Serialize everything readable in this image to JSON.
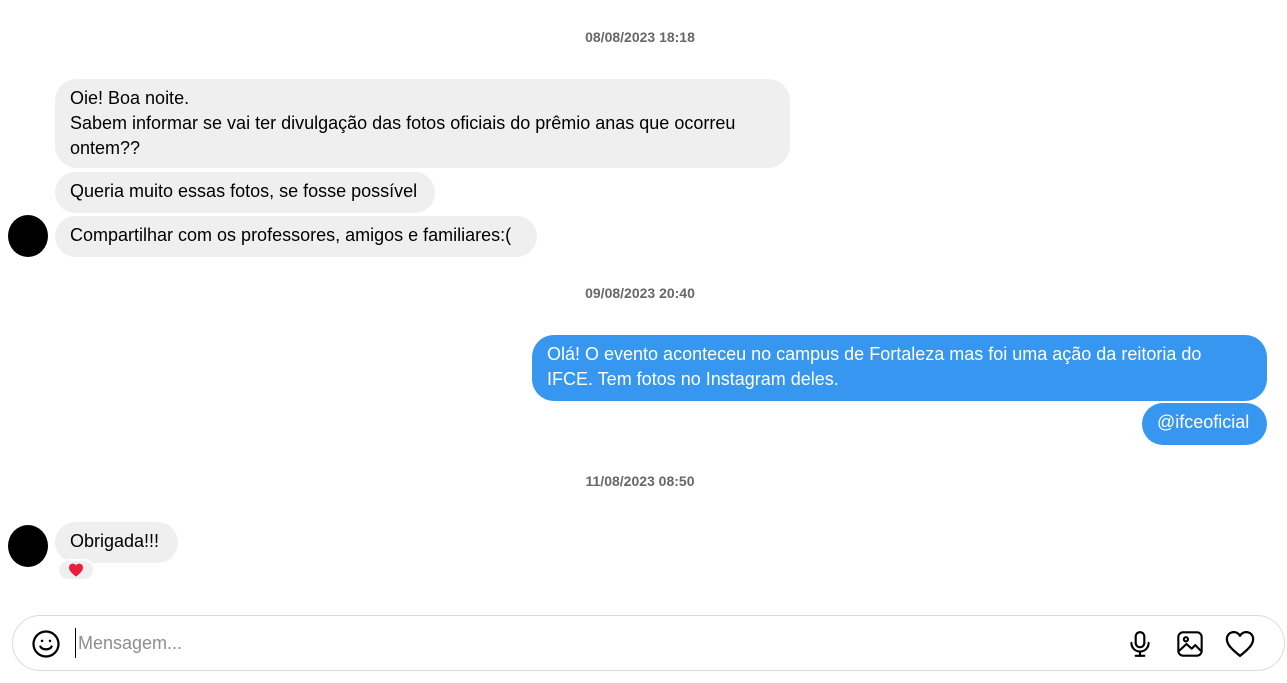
{
  "conversation": {
    "timestamps": [
      "08/08/2023 18:18",
      "09/08/2023 20:40",
      "11/08/2023 08:50"
    ],
    "group1": {
      "messages": [
        "Oie! Boa noite.",
        "Sabem informar se vai ter divulgação das fotos oficiais do prêmio anas que ocorreu ontem??",
        "Queria muito essas fotos, se fosse possível",
        "Compartilhar com os professores, amigos e familiares:("
      ]
    },
    "group2": {
      "messages": [
        "Olá! O evento aconteceu no campus de Fortaleza mas foi uma ação da reitoria do IFCE. Tem fotos no Instagram deles.",
        "@ifceoficial"
      ]
    },
    "group3": {
      "messages": [
        "Obrigada!!!"
      ],
      "reaction": "❤"
    }
  },
  "composer": {
    "placeholder": "Mensagem...",
    "value": ""
  },
  "icons": {
    "emoji": "emoji-icon",
    "microphone": "microphone-icon",
    "image": "image-icon",
    "heart": "heart-icon"
  },
  "colors": {
    "incoming_bubble": "#efefef",
    "outgoing_bubble": "#3797f0",
    "timestamp": "#65676b",
    "reaction_heart": "#ed1c3a"
  }
}
